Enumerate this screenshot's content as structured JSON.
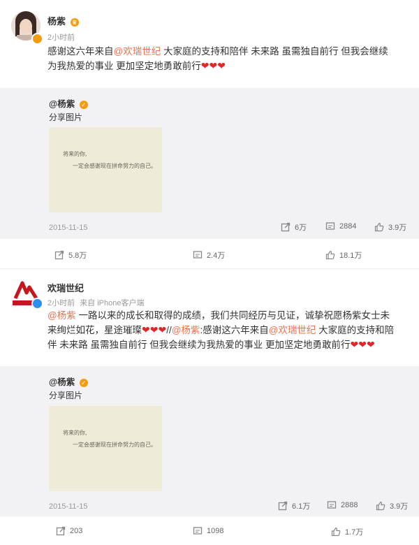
{
  "post1": {
    "author": "杨紫",
    "time": "2小时前",
    "text_a": "感谢这六年来自",
    "mention": "@欢瑞世纪",
    "text_b": " 大家庭的支持和陪伴 未来路 虽需独自前行 但我会继续为我热爱的事业 更加坚定地勇敢前行",
    "hearts": "❤❤❤",
    "repost": {
      "author": "@杨紫",
      "share": "分享图片",
      "image_line1": "将来的你,",
      "image_line2": "一定会感谢现在拼命努力的自己。",
      "date": "2015-11-15",
      "reposts": "6万",
      "comments": "2884",
      "likes": "3.9万"
    },
    "actions": {
      "repost": "5.8万",
      "comment": "2.4万",
      "like": "18.1万"
    }
  },
  "post2": {
    "author": "欢瑞世纪",
    "time": "2小时前",
    "source": "来自 iPhone客户端",
    "mention1": "@杨紫",
    "text_a": " 一路以来的成长和取得的成绩，我们共同经历与见证，诚挚祝愿杨紫女士未来绚烂如花，星途璀璨",
    "hearts1": "❤❤❤",
    "sep": "//",
    "mention2": "@杨紫",
    "text_b": ":感谢这六年来自",
    "mention3": "@欢瑞世纪",
    "text_c": " 大家庭的支持和陪伴 未来路 虽需独自前行 但我会继续为我热爱的事业 更加坚定地勇敢前行",
    "hearts2": "❤❤❤",
    "repost": {
      "author": "@杨紫",
      "share": "分享图片",
      "image_line1": "将来的你,",
      "image_line2": "一定会感谢现在拼命努力的自己。",
      "date": "2015-11-15",
      "reposts": "6.1万",
      "comments": "2888",
      "likes": "3.9万"
    },
    "actions": {
      "repost": "203",
      "comment": "1098",
      "like": "1.7万"
    }
  }
}
